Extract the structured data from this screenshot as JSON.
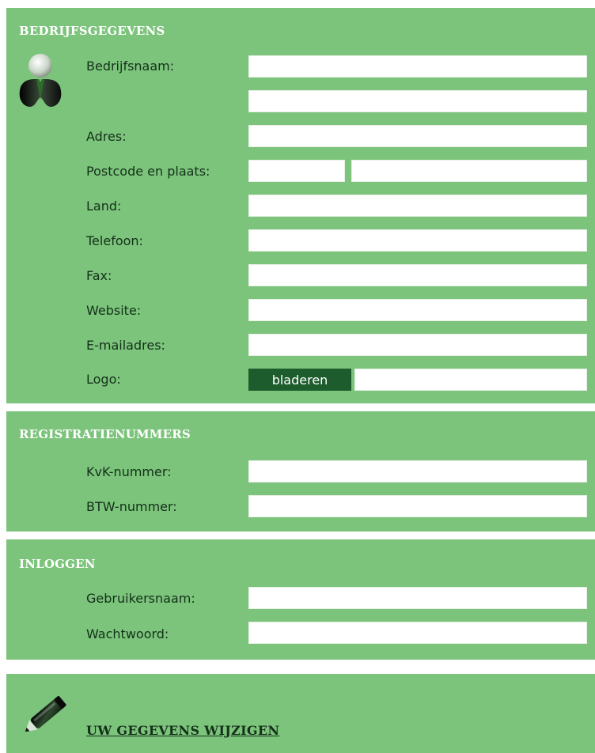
{
  "company": {
    "title": "BEDRIJFSGEGEVENS",
    "labels": {
      "company_name": "Bedrijfsnaam:",
      "address": "Adres:",
      "postcode_city": "Postcode en plaats:",
      "country": "Land:",
      "phone": "Telefoon:",
      "fax": "Fax:",
      "website": "Website:",
      "email": "E-mailadres:",
      "logo": "Logo:"
    },
    "browse_label": "bladeren",
    "icon": "user-icon"
  },
  "registration": {
    "title": "REGISTRATIENUMMERS",
    "labels": {
      "kvk": "KvK-nummer:",
      "btw": "BTW-nummer:"
    }
  },
  "login": {
    "title": "INLOGGEN",
    "labels": {
      "username": "Gebruikersnaam:",
      "password": "Wachtwoord:"
    }
  },
  "action": {
    "link_label": "UW GEGEVENS WIJZIGEN",
    "icon": "pencil-icon"
  },
  "colors": {
    "panel": "#7cc47b",
    "button": "#1d5c2c",
    "text": "#14301a"
  }
}
